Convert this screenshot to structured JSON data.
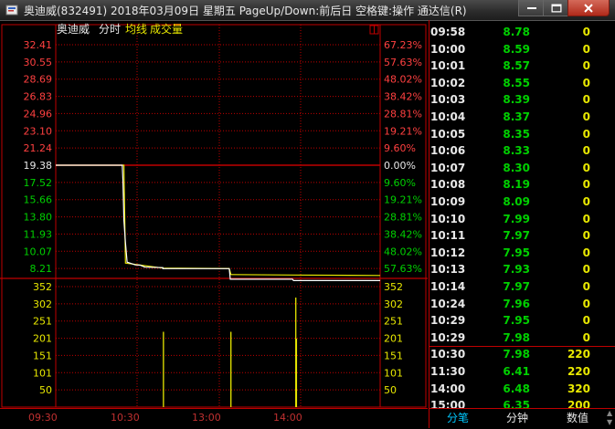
{
  "window": {
    "title": "奥迪威(832491) 2018年03月09日 星期五 PageUp/Down:前后日 空格键:操作 通达信(R)"
  },
  "chart_header": {
    "stock_name": "奥迪威",
    "mode": "分时",
    "avg_line": "均线",
    "volume_label": "成交量"
  },
  "chart_data": {
    "type": "line",
    "price_axis": {
      "ticks_up": [
        "32.41",
        "30.55",
        "28.69",
        "26.83",
        "24.96",
        "23.10",
        "21.24"
      ],
      "baseline": "19.38",
      "ticks_down": [
        "17.52",
        "15.66",
        "13.80",
        "11.93",
        "10.07",
        "8.21"
      ],
      "pct_up": [
        "67.23%",
        "57.63%",
        "48.02%",
        "38.42%",
        "28.81%",
        "19.21%",
        "9.60%"
      ],
      "pct_base": "0.00%",
      "pct_down": [
        "9.60%",
        "19.21%",
        "28.81%",
        "38.42%",
        "48.02%",
        "57.63%"
      ],
      "ylim": [
        7.28,
        32.41
      ]
    },
    "volume_axis": {
      "ticks": [
        "352",
        "302",
        "251",
        "201",
        "151",
        "101",
        "50"
      ],
      "ylim": [
        0,
        352
      ]
    },
    "x_ticks": [
      "09:30",
      "10:30",
      "13:00",
      "14:00"
    ],
    "price_series": [
      {
        "t": 0.0,
        "v": 19.38
      },
      {
        "t": 0.205,
        "v": 19.38
      },
      {
        "t": 0.207,
        "v": 17.8
      },
      {
        "t": 0.21,
        "v": 13.4
      },
      {
        "t": 0.215,
        "v": 11.0
      },
      {
        "t": 0.22,
        "v": 8.9
      },
      {
        "t": 0.245,
        "v": 8.6
      },
      {
        "t": 0.26,
        "v": 8.57
      },
      {
        "t": 0.275,
        "v": 8.35
      },
      {
        "t": 0.33,
        "v": 8.3
      },
      {
        "t": 0.33,
        "v": 8.19
      },
      {
        "t": 0.535,
        "v": 8.19
      },
      {
        "t": 0.538,
        "v": 7.05
      },
      {
        "t": 0.73,
        "v": 7.05
      },
      {
        "t": 0.733,
        "v": 6.9
      },
      {
        "t": 1.0,
        "v": 6.9
      }
    ],
    "avg_series": [
      {
        "t": 0.0,
        "v": 19.38
      },
      {
        "t": 0.21,
        "v": 19.38
      },
      {
        "t": 0.215,
        "v": 8.8
      },
      {
        "t": 0.33,
        "v": 8.25
      },
      {
        "t": 0.535,
        "v": 8.2
      },
      {
        "t": 0.54,
        "v": 7.55
      },
      {
        "t": 0.73,
        "v": 7.5
      },
      {
        "t": 1.0,
        "v": 7.45
      }
    ],
    "volume_bars": [
      {
        "t": 0.332,
        "v": 220
      },
      {
        "t": 0.54,
        "v": 220
      },
      {
        "t": 0.74,
        "v": 320
      },
      {
        "t": 0.742,
        "v": 200
      }
    ]
  },
  "ticks_list": [
    {
      "time": "09:58",
      "price": "8.78",
      "vol": "0"
    },
    {
      "time": "10:00",
      "price": "8.59",
      "vol": "0"
    },
    {
      "time": "10:01",
      "price": "8.57",
      "vol": "0"
    },
    {
      "time": "10:02",
      "price": "8.55",
      "vol": "0"
    },
    {
      "time": "10:03",
      "price": "8.39",
      "vol": "0"
    },
    {
      "time": "10:04",
      "price": "8.37",
      "vol": "0"
    },
    {
      "time": "10:05",
      "price": "8.35",
      "vol": "0"
    },
    {
      "time": "10:06",
      "price": "8.33",
      "vol": "0"
    },
    {
      "time": "10:07",
      "price": "8.30",
      "vol": "0"
    },
    {
      "time": "10:08",
      "price": "8.19",
      "vol": "0"
    },
    {
      "time": "10:09",
      "price": "8.09",
      "vol": "0"
    },
    {
      "time": "10:10",
      "price": "7.99",
      "vol": "0"
    },
    {
      "time": "10:11",
      "price": "7.97",
      "vol": "0"
    },
    {
      "time": "10:12",
      "price": "7.95",
      "vol": "0"
    },
    {
      "time": "10:13",
      "price": "7.93",
      "vol": "0"
    },
    {
      "time": "10:14",
      "price": "7.97",
      "vol": "0"
    },
    {
      "time": "10:24",
      "price": "7.96",
      "vol": "0"
    },
    {
      "time": "10:29",
      "price": "7.95",
      "vol": "0"
    },
    {
      "time": "10:29",
      "price": "7.98",
      "vol": "0"
    },
    {
      "time": "10:30",
      "price": "7.98",
      "vol": "220"
    },
    {
      "time": "11:30",
      "price": "6.41",
      "vol": "220"
    },
    {
      "time": "14:00",
      "price": "6.48",
      "vol": "320"
    },
    {
      "time": "15:00",
      "price": "6.35",
      "vol": "200"
    }
  ],
  "tabs": [
    {
      "label": "分笔"
    },
    {
      "label": "分钟"
    },
    {
      "label": "数值"
    }
  ],
  "colors": {
    "grid": "#c00000",
    "up": "#ff4040",
    "down": "#00d000",
    "price_line": "#ffffff",
    "avg_line": "#e8e800",
    "volume": "#e8e800"
  }
}
